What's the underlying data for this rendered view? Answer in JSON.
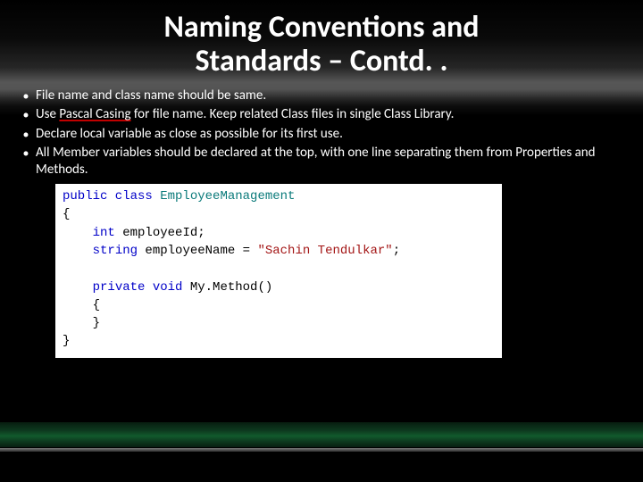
{
  "title_line1": "Naming Conventions and",
  "title_line2": "Standards – Contd. .",
  "bullets": [
    {
      "text_a": "File name and class name should be same."
    },
    {
      "text_a": "Use ",
      "link": "Pascal Casing",
      "text_b": " for file name. Keep related Class files in single Class Library."
    },
    {
      "text_a": "Declare local variable as close as possible for its first use."
    },
    {
      "text_a": "All Member variables should be declared at the top, with one line separating them from Properties and Methods."
    }
  ],
  "code": {
    "l1_kw": "public class",
    "l1_ty": " EmployeeManagement",
    "l2": "{",
    "l3_pad": "    ",
    "l3_kw": "int",
    "l3_rest": " employeeId;",
    "l4_pad": "    ",
    "l4_kw": "string",
    "l4_rest_a": " employeeName = ",
    "l4_str": "\"Sachin Tendulkar\"",
    "l4_rest_b": ";",
    "blank": " ",
    "l6_pad": "    ",
    "l6_kw": "private void",
    "l6_rest": " My.Method()",
    "l7": "    {",
    "l8": "    }",
    "l9": "}"
  }
}
